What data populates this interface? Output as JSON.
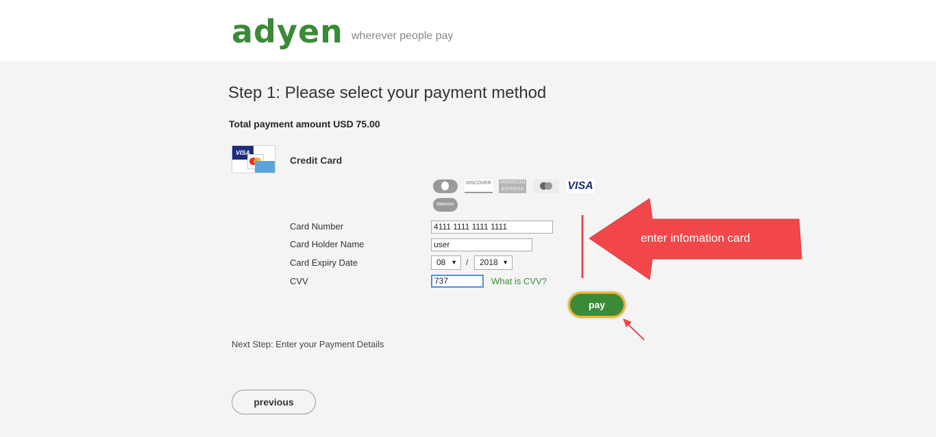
{
  "header": {
    "logo": "adyen",
    "tagline": "wherever people pay"
  },
  "step_title": "Step 1: Please select your payment method",
  "total_amount": "Total payment amount USD 75.00",
  "payment_method": {
    "label": "Credit Card",
    "accepted_brands": [
      "diners",
      "discover",
      "american-express",
      "mastercard",
      "visa",
      "maestro"
    ],
    "brand_texts": {
      "thumb_visa": "VISA",
      "discover": "DISCOVER",
      "amex": "AMERICAN EXPRESS",
      "visa": "VISA",
      "maestro": "Maestro"
    }
  },
  "form": {
    "card_number": {
      "label": "Card Number",
      "value": "4111 1111 1111 1111"
    },
    "holder_name": {
      "label": "Card Holder Name",
      "value": "user"
    },
    "expiry": {
      "label": "Card Expiry Date",
      "month": "08",
      "separator": "/",
      "year": "2018"
    },
    "cvv": {
      "label": "CVV",
      "value": "737",
      "help_link": "What is CVV?"
    }
  },
  "buttons": {
    "pay": "pay",
    "previous": "previous"
  },
  "next_step": "Next Step: Enter your Payment Details",
  "annotation": {
    "text": "enter infomation card",
    "color": "#f2474a"
  },
  "colors": {
    "brand_green": "#3b8a37",
    "highlight": "#f0b429",
    "page_bg": "#f4f4f4"
  }
}
